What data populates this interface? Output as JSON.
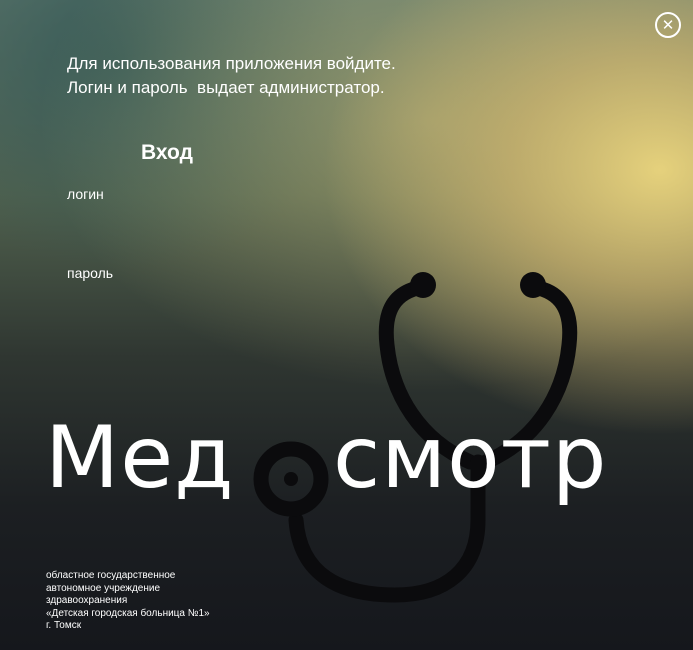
{
  "intro": {
    "line1": "Для использования приложения войдите.",
    "line2": "Логин и пароль  выдает администратор."
  },
  "close_icon": "close-icon",
  "form": {
    "title": "Вход",
    "login_label": "логин",
    "password_label": "пароль",
    "login_value": "",
    "password_value": ""
  },
  "logo": {
    "part1": "Мед",
    "part2": "смотр",
    "icon": "stethoscope-icon"
  },
  "organization": {
    "line1": "областное государственное",
    "line2": "автономное учреждение",
    "line3": "здравоохранения",
    "line4": "«Детская городская больница №1»",
    "line5": "г. Томск"
  },
  "colors": {
    "text": "#ffffff",
    "stethoscope": "#0b0b0d",
    "background_glow": "#ecd67e"
  }
}
